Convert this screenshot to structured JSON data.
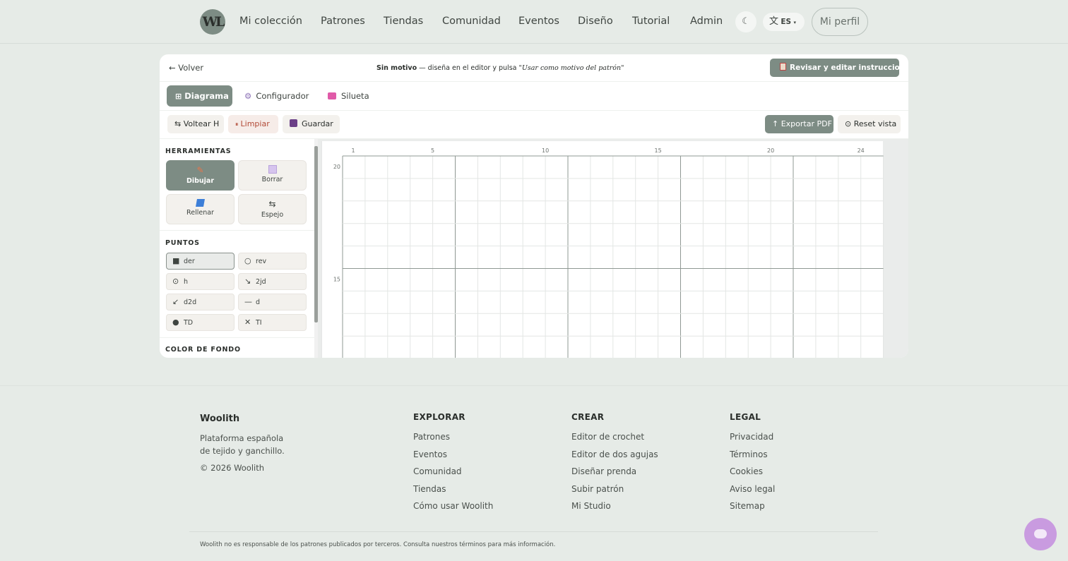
{
  "nav": {
    "logo_text": "WL",
    "links": [
      "Mi colección",
      "Patrones",
      "Tiendas",
      "Comunidad",
      "Eventos",
      "Diseño",
      "Tutorial",
      "Admin"
    ],
    "theme_icon": "moon-icon",
    "lang_label": "ES",
    "profile_label": "Mi perfil"
  },
  "editor": {
    "back_label": "← Volver",
    "hint_bold": "Sin motivo",
    "hint_text": " — diseña en el editor y pulsa ",
    "hint_quote": "\"Usar como motivo del patrón\"",
    "review_label": "Revisar y editar instrucciones",
    "tabs": [
      {
        "label": "Diagrama",
        "icon": "grid-icon"
      },
      {
        "label": "Configurador",
        "icon": "gear-icon"
      },
      {
        "label": "Silueta",
        "icon": "shirt-icon"
      }
    ],
    "toolbar": {
      "flip_label": "⇆ Voltear H",
      "clear_label": "Limpiar",
      "save_label": "Guardar",
      "export_label": "↑ Exportar PDF",
      "reset_label": "⊙ Reset vista"
    },
    "panel": {
      "tools_title": "HERRAMIENTAS",
      "tools": [
        {
          "label": "Dibujar",
          "icon": "pencil-icon"
        },
        {
          "label": "Borrar",
          "icon": "eraser-icon"
        },
        {
          "label": "Rellenar",
          "icon": "fill-icon"
        },
        {
          "label": "Espejo",
          "icon": "mirror-icon"
        }
      ],
      "stitches_title": "PUNTOS",
      "stitches": [
        {
          "symbol": "■",
          "label": "der"
        },
        {
          "symbol": "○",
          "label": "rev"
        },
        {
          "symbol": "⊙",
          "label": "h"
        },
        {
          "symbol": "↘",
          "label": "2jd"
        },
        {
          "symbol": "↙",
          "label": "d2d"
        },
        {
          "symbol": "—",
          "label": "d"
        },
        {
          "symbol": "●",
          "label": "TD"
        },
        {
          "symbol": "✕",
          "label": "TI"
        }
      ],
      "bg_color_title": "COLOR DE FONDO"
    },
    "grid": {
      "col_labels": [
        "1",
        "5",
        "10",
        "15",
        "20",
        "24"
      ],
      "row_labels": [
        "20",
        "15"
      ],
      "columns": 24,
      "major_every": 5
    }
  },
  "footer": {
    "brand": "Woolith",
    "description": "Plataforma española de tejido y ganchillo.",
    "copyright": "© 2026 Woolith",
    "columns": [
      {
        "title": "EXPLORAR",
        "links": [
          "Patrones",
          "Eventos",
          "Comunidad",
          "Tiendas",
          "Cómo usar Woolith"
        ]
      },
      {
        "title": "CREAR",
        "links": [
          "Editor de crochet",
          "Editor de dos agujas",
          "Diseñar prenda",
          "Subir patrón",
          "Mi Studio"
        ]
      },
      {
        "title": "LEGAL",
        "links": [
          "Privacidad",
          "Términos",
          "Cookies",
          "Aviso legal",
          "Sitemap"
        ]
      }
    ],
    "disclaimer": "Woolith no es responsable de los patrones publicados por terceros. Consulta nuestros términos para más información."
  },
  "colors": {
    "accent": "#7d8c84",
    "background": "#e6ebe7",
    "danger": "#b24a37",
    "chat": "#c99be0"
  }
}
